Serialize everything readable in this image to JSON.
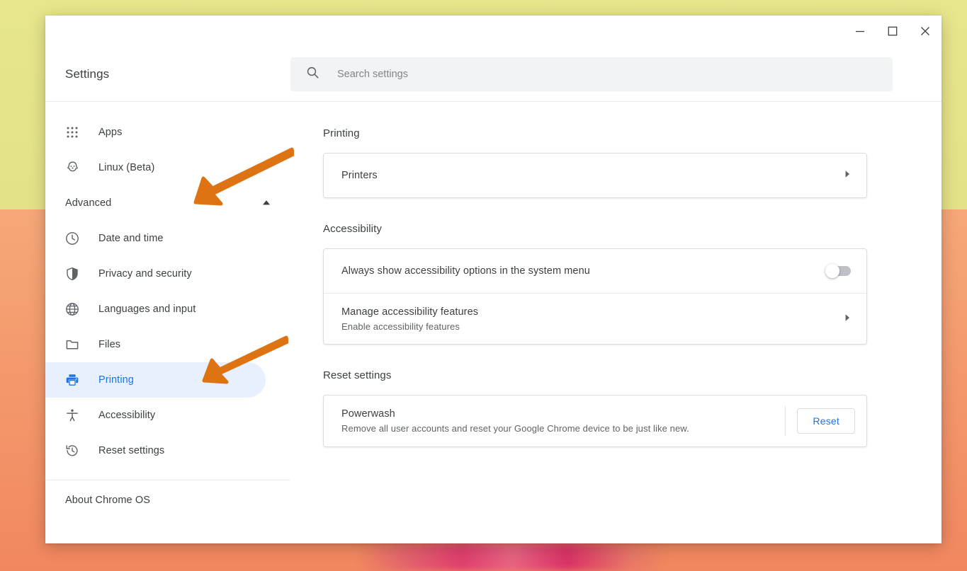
{
  "window": {
    "title": "Settings",
    "controls": [
      {
        "name": "minimize",
        "label": "Minimize"
      },
      {
        "name": "maximize",
        "label": "Maximize"
      },
      {
        "name": "close",
        "label": "Close"
      }
    ]
  },
  "search": {
    "placeholder": "Search settings",
    "value": "",
    "icon": "search-icon"
  },
  "sidebar": {
    "top_items": [
      {
        "label": "Apps",
        "icon": "apps-grid-icon"
      },
      {
        "label": "Linux (Beta)",
        "icon": "penguin-icon"
      }
    ],
    "advanced": {
      "label": "Advanced",
      "expanded": true,
      "icon": "chevron-up-icon"
    },
    "advanced_items": [
      {
        "label": "Date and time",
        "icon": "clock-icon",
        "selected": false
      },
      {
        "label": "Privacy and security",
        "icon": "shield-icon",
        "selected": false
      },
      {
        "label": "Languages and input",
        "icon": "globe-icon",
        "selected": false
      },
      {
        "label": "Files",
        "icon": "folder-icon",
        "selected": false
      },
      {
        "label": "Printing",
        "icon": "printer-icon",
        "selected": true
      },
      {
        "label": "Accessibility",
        "icon": "accessibility-person-icon",
        "selected": false
      },
      {
        "label": "Reset settings",
        "icon": "history-restore-icon",
        "selected": false
      }
    ],
    "about": {
      "label": "About Chrome OS"
    }
  },
  "main": {
    "printing": {
      "heading": "Printing",
      "rows": [
        {
          "title": "Printers",
          "icon": "chevron-right-icon"
        }
      ]
    },
    "accessibility": {
      "heading": "Accessibility",
      "toggle_row": {
        "title": "Always show accessibility options in the system menu",
        "toggle_state": "off"
      },
      "manage_row": {
        "title": "Manage accessibility features",
        "subtitle": "Enable accessibility features",
        "icon": "chevron-right-icon"
      }
    },
    "reset": {
      "heading": "Reset settings",
      "powerwash": {
        "title": "Powerwash",
        "subtitle": "Remove all user accounts and reset your Google Chrome device to be just like new.",
        "button_label": "Reset"
      }
    }
  },
  "annotations": {
    "arrows": [
      {
        "name": "arrow-pointing-to-advanced",
        "color": "#dd7313"
      },
      {
        "name": "arrow-pointing-to-printing",
        "color": "#dd7313"
      }
    ]
  },
  "colors": {
    "accent_blue": "#1a73e8",
    "selected_pill": "#e8f0fe",
    "text_primary": "#3c4043",
    "text_secondary": "#5f6368",
    "annotation_orange": "#dd7313"
  }
}
